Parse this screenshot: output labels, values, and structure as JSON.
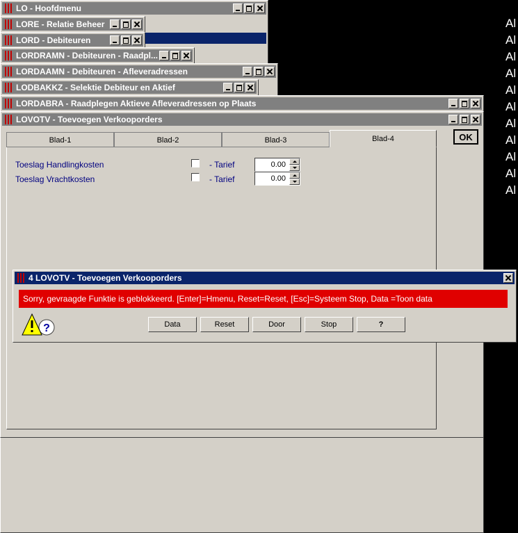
{
  "windows": {
    "lo": {
      "title": "LO - Hoofdmenu"
    },
    "lore": {
      "title": "LORE - Relatie Beheer"
    },
    "lord": {
      "title": "LORD - Debiteuren"
    },
    "lordramn": {
      "title": "LORDRAMN - Debiteuren - Raadpl..."
    },
    "lordaamn": {
      "title": "LORDAAMN - Debiteuren - Afleveradressen"
    },
    "lodbakkz": {
      "title": "LODBAKKZ - Selektie Debiteur en Aktief"
    },
    "lordabra": {
      "title": "LORDABRA - Raadplegen Aktieve Afleveradressen op Plaats"
    },
    "lovotv": {
      "title": "LOVOTV - Toevoegen Verkooporders"
    }
  },
  "tabs": [
    "Blad-1",
    "Blad-2",
    "Blad-3",
    "Blad-4"
  ],
  "active_tab": "Blad-4",
  "ok_label": "OK",
  "form": {
    "row1": {
      "label": "Toeslag Handlingkosten",
      "tarief_label": "- Tarief",
      "value": "0.00"
    },
    "row2": {
      "label": "Toeslag Vrachtkosten",
      "tarief_label": "- Tarief",
      "value": "0.00"
    }
  },
  "dialog": {
    "title": "4 LOVOTV - Toevoegen Verkooporders",
    "message": "Sorry, gevraagde Funktie is geblokkeerd.  [Enter]=Hmenu, Reset=Reset, [Esc]=Systeem Stop, Data =Toon data",
    "buttons": [
      "Data",
      "Reset",
      "Door",
      "Stop",
      "?"
    ]
  },
  "background_text": [
    "Al",
    "Al",
    "Al",
    "Al",
    "Al",
    "Al",
    "Al",
    "Al",
    "Al",
    "Al",
    "Al"
  ],
  "colors": {
    "active_title": "#0a246a",
    "inactive_title": "#808080",
    "error_bar": "#e00000",
    "label_text": "#000080"
  }
}
